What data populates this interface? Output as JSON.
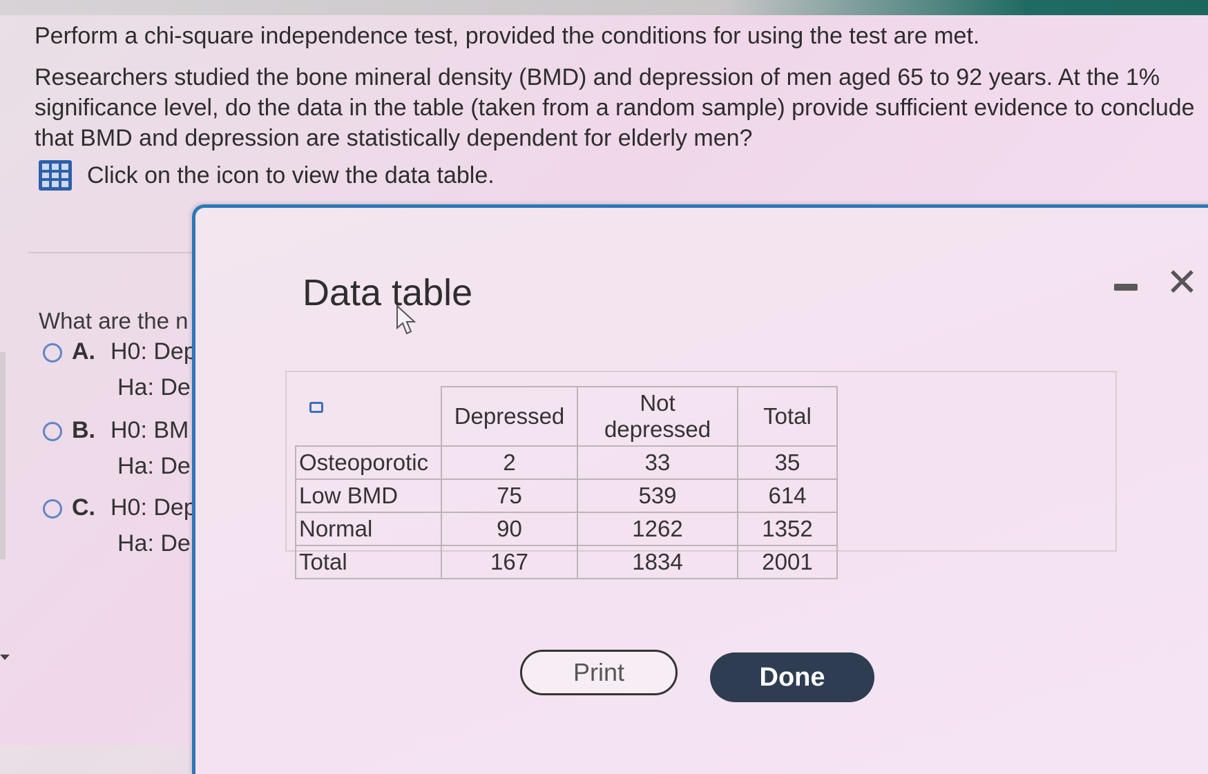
{
  "question": {
    "line1": "Perform a chi-square independence test, provided the conditions for using the test are met.",
    "line2": "Researchers studied the bone mineral density (BMD) and depression of men aged 65 to 92 years. At the 1% significance level, do the data in the table (taken from a random sample) provide sufficient evidence to conclude that BMD and depression are statistically dependent for elderly men?",
    "view_table_text": "Click on the icon to view the data table.",
    "prompt": "What are the n",
    "icon_name": "grid-table-icon"
  },
  "options": [
    {
      "letter": "A.",
      "h0": "H0: Dep",
      "ha": "Ha: Dep"
    },
    {
      "letter": "B.",
      "h0": "H0: BM",
      "ha": "Ha: Dep"
    },
    {
      "letter": "C.",
      "h0": "H0: Dep",
      "ha": "Ha: Dep"
    }
  ],
  "modal": {
    "title": "Data table",
    "minimize_icon": "minimize-icon",
    "close_icon": "close-icon",
    "close_glyph": "✕",
    "print_label": "Print",
    "done_label": "Done",
    "copy_icon": "copy-table-icon"
  },
  "table": {
    "headers": [
      "Depressed",
      "Not depressed",
      "Total"
    ],
    "rows": [
      {
        "label": "Osteoporotic",
        "values": [
          "2",
          "33",
          "35"
        ]
      },
      {
        "label": "Low BMD",
        "values": [
          "75",
          "539",
          "614"
        ]
      },
      {
        "label": "Normal",
        "values": [
          "90",
          "1262",
          "1352"
        ]
      },
      {
        "label": "Total",
        "values": [
          "167",
          "1834",
          "2001"
        ]
      }
    ]
  },
  "colors": {
    "accent": "#2c78b8",
    "done_bg": "#2f3d52",
    "radio": "#5f86c8"
  }
}
